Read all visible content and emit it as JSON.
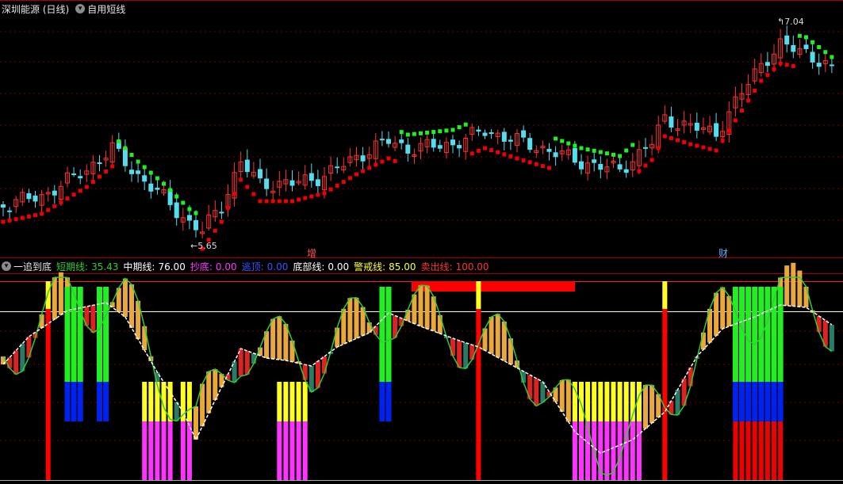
{
  "header": {
    "symbol_label": "深圳能源 (日线)",
    "formula_label": "自用短线"
  },
  "price_panel": {
    "high_annotation": "7.04",
    "low_annotation": "5.65",
    "marker_zeng": "增",
    "marker_cai": "财"
  },
  "indicator_panel": {
    "name": "一追到底",
    "items": [
      {
        "label": "短期线:",
        "value": "35.43",
        "color": "#33cc33"
      },
      {
        "label": "中期线:",
        "value": "76.00",
        "color": "#ffffff"
      },
      {
        "label": "抄底:",
        "value": "0.00",
        "color": "#ff33ff"
      },
      {
        "label": "逃顶:",
        "value": "0.00",
        "color": "#3355ff"
      },
      {
        "label": "底部线:",
        "value": "0.00",
        "color": "#ffffff"
      },
      {
        "label": "警戒线:",
        "value": "85.00",
        "color": "#ffff33"
      },
      {
        "label": "卖出线:",
        "value": "100.00",
        "color": "#ff3333"
      }
    ]
  },
  "colors": {
    "up": "#ff3333",
    "down": "#55ddee",
    "support": "#ee0000",
    "resistance": "#22ee22",
    "short_line": "#33cc33",
    "mid_line": "#ffffff",
    "warn": "#ffff00",
    "sell": "#ff0000",
    "bottom": "#ff33ff",
    "top_escape": "#0022ee",
    "grid": "#7a0000"
  },
  "icons": {
    "collapse_1": "chevron-down-icon",
    "collapse_2": "chevron-down-icon",
    "collapse_3": "chevron-down-icon"
  }
}
